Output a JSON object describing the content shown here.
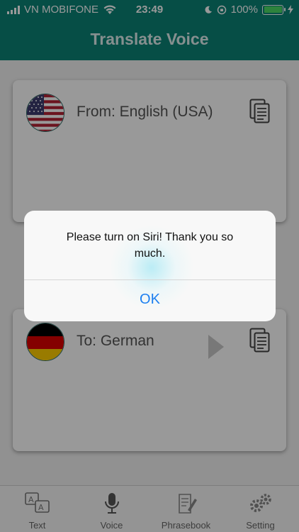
{
  "status_bar": {
    "carrier": "VN MOBIFONE",
    "time": "23:49",
    "battery": "100%"
  },
  "nav": {
    "title": "Translate Voice"
  },
  "source_card": {
    "label": "From: English (USA)",
    "flag_icon": "usa-flag-icon",
    "copy_icon": "copy-icon"
  },
  "target_card": {
    "label": "To: German",
    "flag_icon": "germany-flag-icon",
    "play_icon": "play-icon",
    "copy_icon": "copy-icon"
  },
  "alert": {
    "message": "Please turn on Siri! Thank you so much.",
    "ok_label": "OK"
  },
  "tabs": [
    {
      "label": "Text",
      "icon": "text-translate-icon"
    },
    {
      "label": "Voice",
      "icon": "microphone-icon"
    },
    {
      "label": "Phrasebook",
      "icon": "phrasebook-icon"
    },
    {
      "label": "Setting",
      "icon": "gears-icon"
    }
  ],
  "colors": {
    "header": "#0a8276",
    "alert_button": "#1d7ff0",
    "battery_fill": "#4cd964"
  }
}
